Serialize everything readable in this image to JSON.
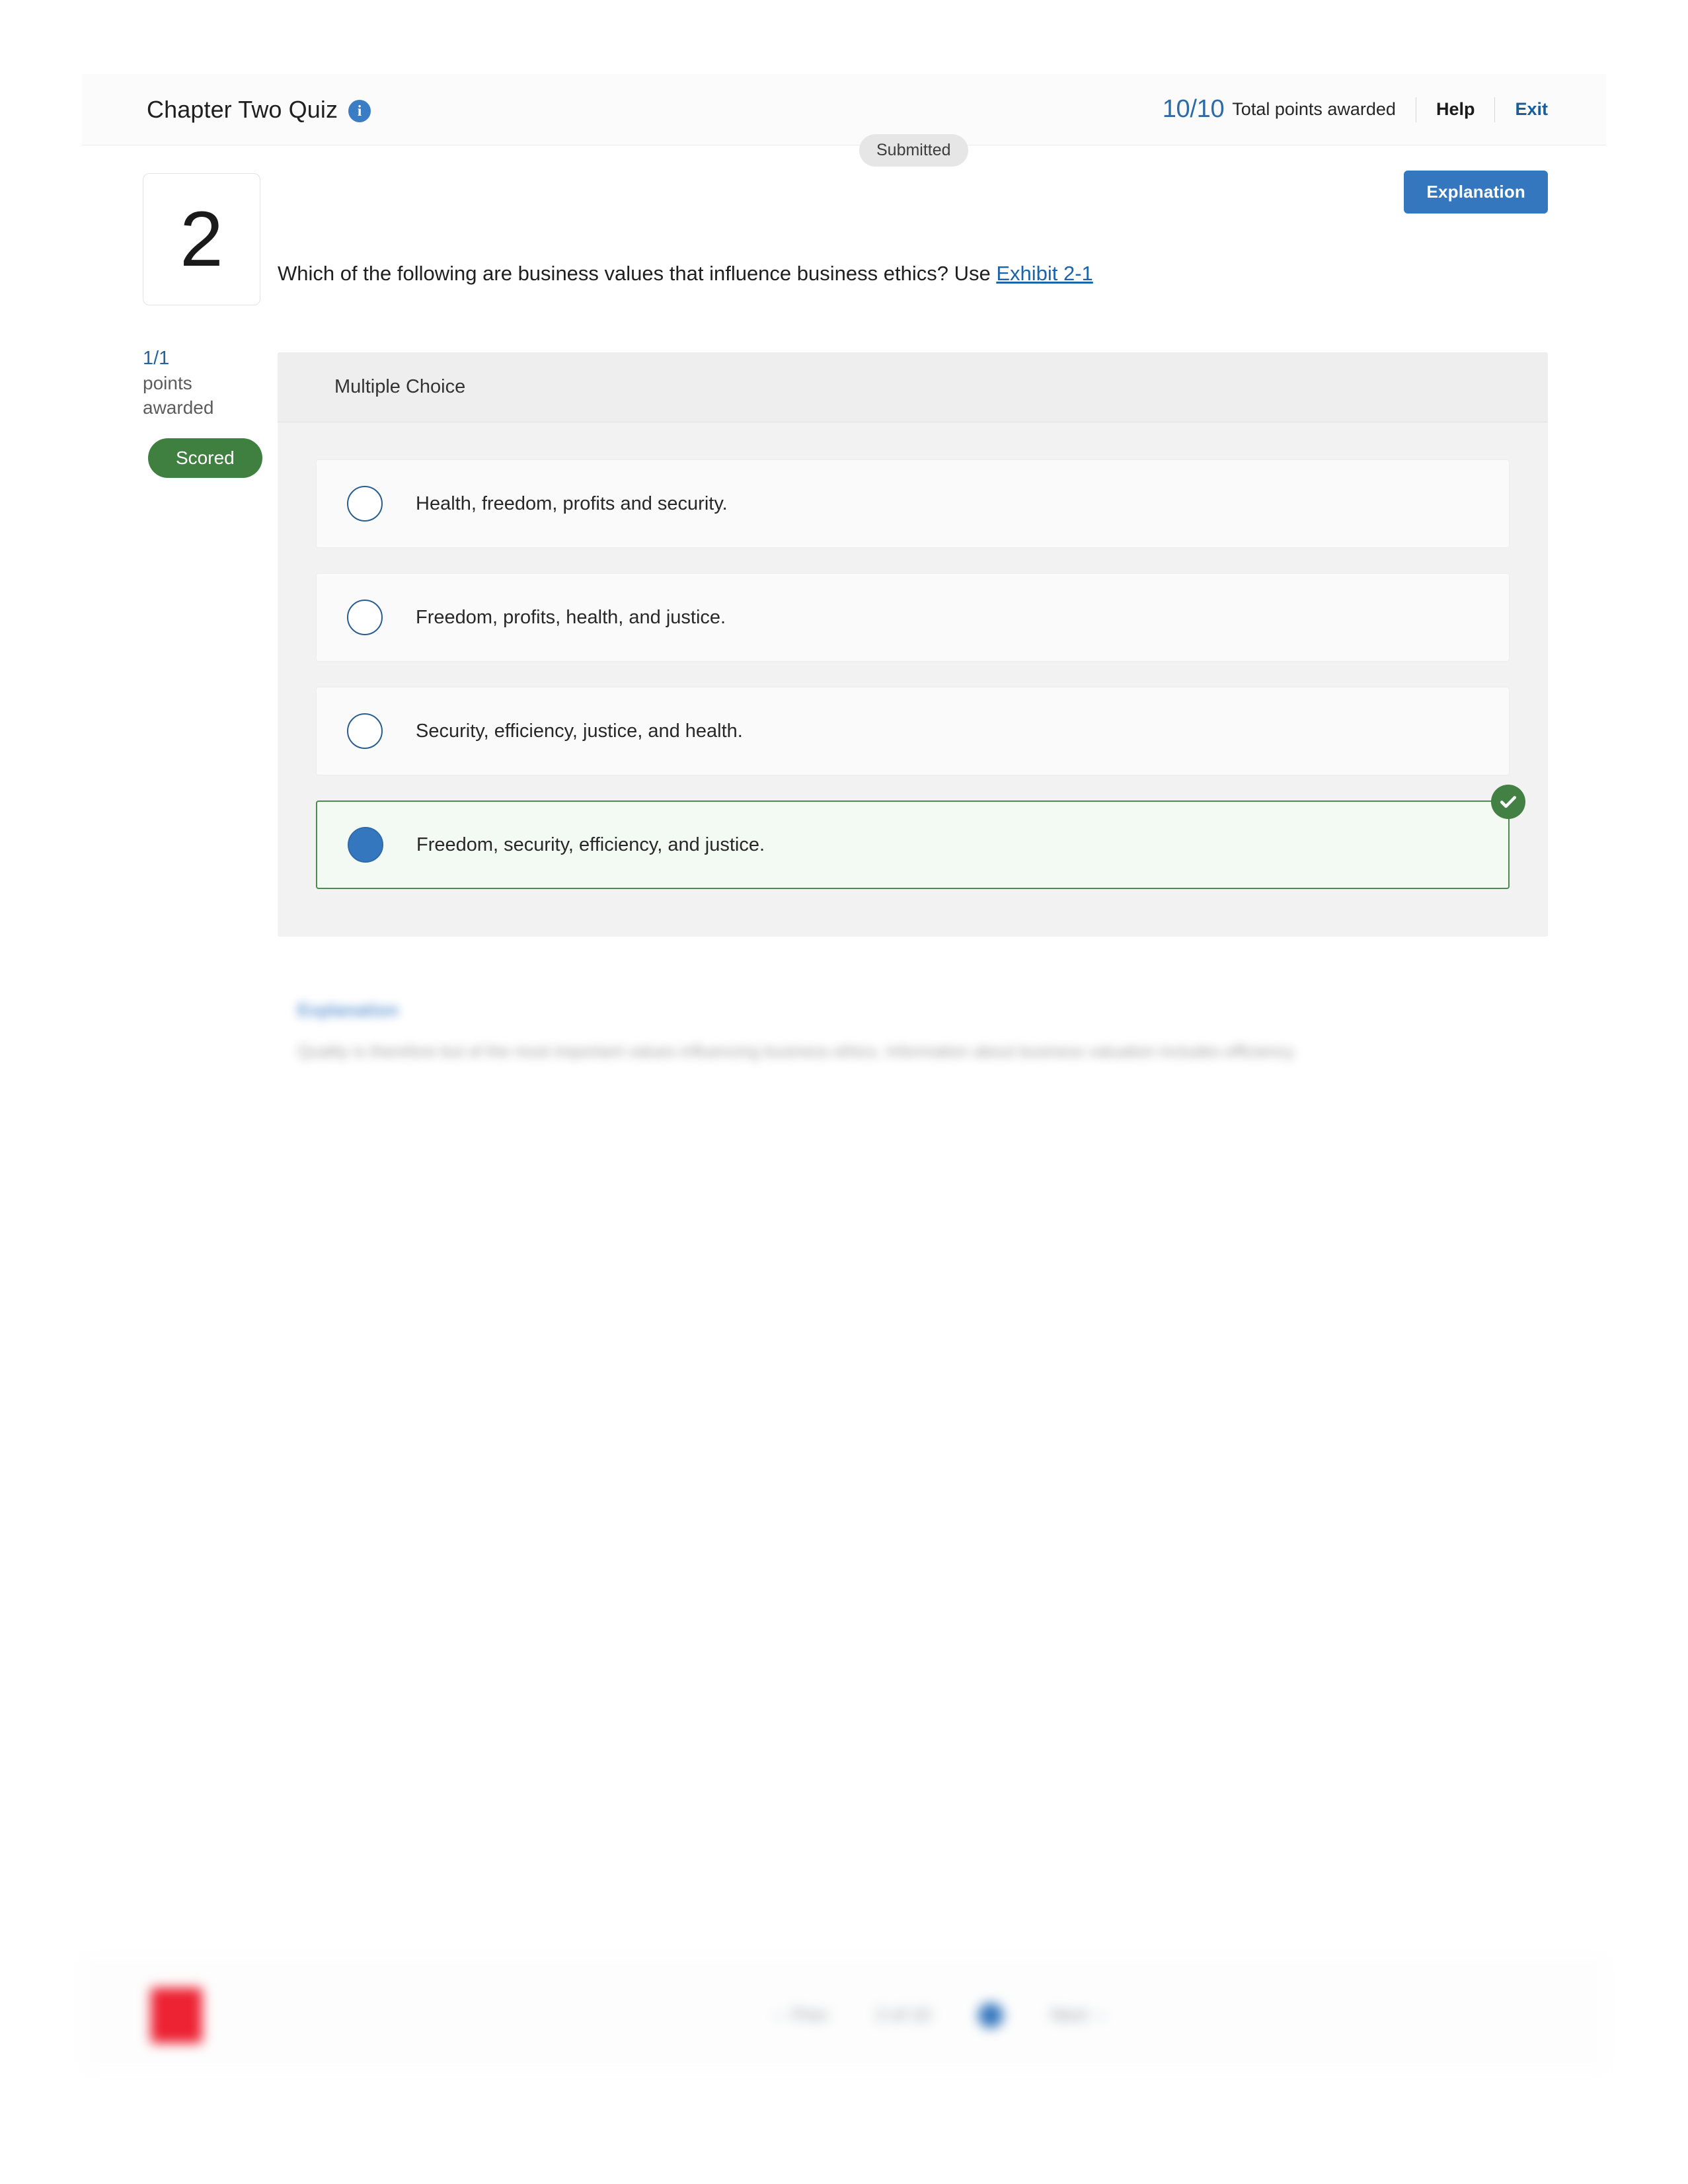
{
  "header": {
    "quiz_title": "Chapter Two Quiz",
    "info_icon": "info-icon",
    "status_chip": "Submitted",
    "points_score": "10/10",
    "points_label": "Total points awarded",
    "help_link": "Help",
    "exit_link": "Exit"
  },
  "toolbar": {
    "explanation_label": "Explanation"
  },
  "rail": {
    "question_number": "2",
    "points_awarded": "1/1",
    "points_awarded_label": "points awarded",
    "scored_badge": "Scored"
  },
  "question": {
    "text_before_link": "Which of the following are business values that influence business ethics? Use ",
    "link_label": "Exhibit 2-1",
    "panel_header": "Multiple Choice",
    "options": [
      {
        "label": "Health, freedom, profits and security.",
        "selected": false,
        "correct": false
      },
      {
        "label": "Freedom, profits, health, and justice.",
        "selected": false,
        "correct": false
      },
      {
        "label": "Security, efficiency, justice, and health.",
        "selected": false,
        "correct": false
      },
      {
        "label": "Freedom, security, efficiency, and justice.",
        "selected": true,
        "correct": true
      }
    ]
  },
  "explanation": {
    "title": "Explanation",
    "body": "Quality is therefore but of the most important values influencing business ethics. Information about business valuation includes efficiency."
  },
  "bottom_bar": {
    "items": [
      "Prev",
      "2 of 10",
      "Next"
    ]
  },
  "colors": {
    "accent_blue": "#3577bf",
    "link_blue": "#1b63ab",
    "score_blue": "#2c6aa8",
    "correct_green": "#428043",
    "scored_green": "#3f8040",
    "panel_gray": "#f2f2f2",
    "logo_red": "#ed2233"
  }
}
